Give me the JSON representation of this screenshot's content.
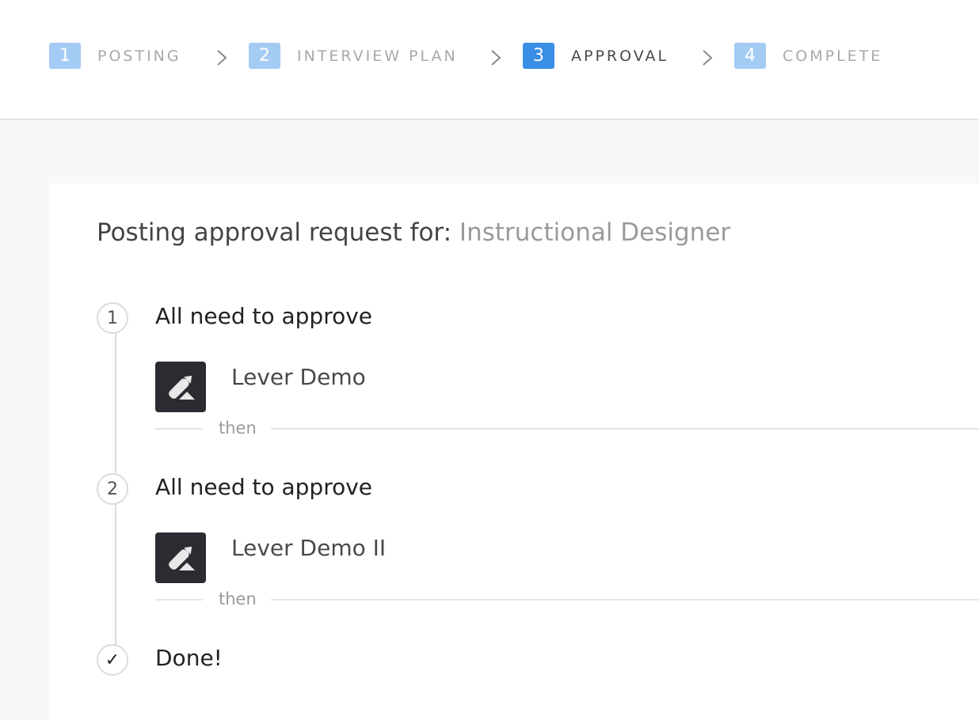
{
  "stepper": {
    "steps": [
      {
        "number": "1",
        "label": "POSTING",
        "state": "done"
      },
      {
        "number": "2",
        "label": "INTERVIEW PLAN",
        "state": "done"
      },
      {
        "number": "3",
        "label": "APPROVAL",
        "state": "active"
      },
      {
        "number": "4",
        "label": "COMPLETE",
        "state": "pending"
      }
    ],
    "separator_icon": "chevron-right-icon",
    "colors": {
      "step_badge": "#a3cbf4",
      "active_badge": "#3a8ee6"
    }
  },
  "card": {
    "title_prefix": "Posting approval request for:",
    "job_title": "Instructional Designer",
    "stages": [
      {
        "number": "1",
        "heading": "All need to approve",
        "approver": {
          "name": "Lever Demo",
          "avatar_icon": "lever-logo-icon"
        },
        "separator": "then"
      },
      {
        "number": "2",
        "heading": "All need to approve",
        "approver": {
          "name": "Lever Demo II",
          "avatar_icon": "lever-logo-icon"
        },
        "separator": "then"
      }
    ],
    "final": {
      "icon": "checkmark-icon",
      "symbol": "✓",
      "label": "Done!"
    }
  }
}
